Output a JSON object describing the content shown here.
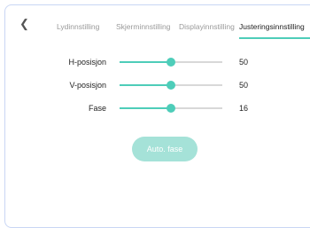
{
  "header": {
    "back_icon": "chevron-left-icon",
    "tabs": [
      {
        "label": "Lydinnstilling",
        "active": false
      },
      {
        "label": "Skjerminnstilling",
        "active": false
      },
      {
        "label": "Displayinnstilling",
        "active": false
      },
      {
        "label": "Justeringsinnstilling",
        "active": true
      }
    ]
  },
  "adjust": {
    "rows": [
      {
        "label": "H-posisjon",
        "value": "50",
        "level": 0.5
      },
      {
        "label": "V-posisjon",
        "value": "50",
        "level": 0.5
      },
      {
        "label": "Fase",
        "value": "16",
        "level": 0.5
      }
    ],
    "auto_button": "Auto. fase"
  },
  "colors": {
    "accent": "#4ecdb9",
    "button": "#a5e2d8",
    "track": "#d8d8d8",
    "panel_border": "#c9d6f4"
  }
}
